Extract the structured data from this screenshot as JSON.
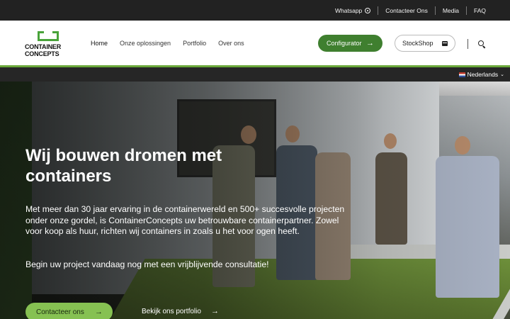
{
  "topbar": {
    "links": [
      {
        "label": "Whatsapp",
        "icon": "whatsapp-icon"
      },
      {
        "label": "Contacteer Ons"
      },
      {
        "label": "Media"
      },
      {
        "label": "FAQ"
      }
    ]
  },
  "logo": {
    "line1": "CONTAINER",
    "line2": "CONCEPTS"
  },
  "nav": {
    "items": [
      {
        "label": "Home",
        "active": true
      },
      {
        "label": "Onze oplossingen"
      },
      {
        "label": "Portfolio"
      },
      {
        "label": "Over ons"
      }
    ],
    "configurator_label": "Configurator",
    "stockshop_label": "StockShop"
  },
  "lang": {
    "label": "Nederlands"
  },
  "hero": {
    "title": "Wij bouwen dromen met containers",
    "body": "Met meer dan 30 jaar ervaring in de containerwereld en 500+ succesvolle projecten onder onze gordel, is ContainerConcepts uw betrouwbare containerpartner. Zowel voor koop als huur, richten wij containers in zoals u het voor ogen heeft.",
    "cta_text": "Begin uw project vandaag nog met een vrijblijvende consultatie!",
    "primary_button": "Contacteer ons",
    "secondary_button": "Bekijk ons portfolio"
  },
  "colors": {
    "brand_green": "#49a33a",
    "button_green_dark": "#3f7f2f",
    "button_green_light": "#86c152",
    "topbar_bg": "#222222"
  }
}
